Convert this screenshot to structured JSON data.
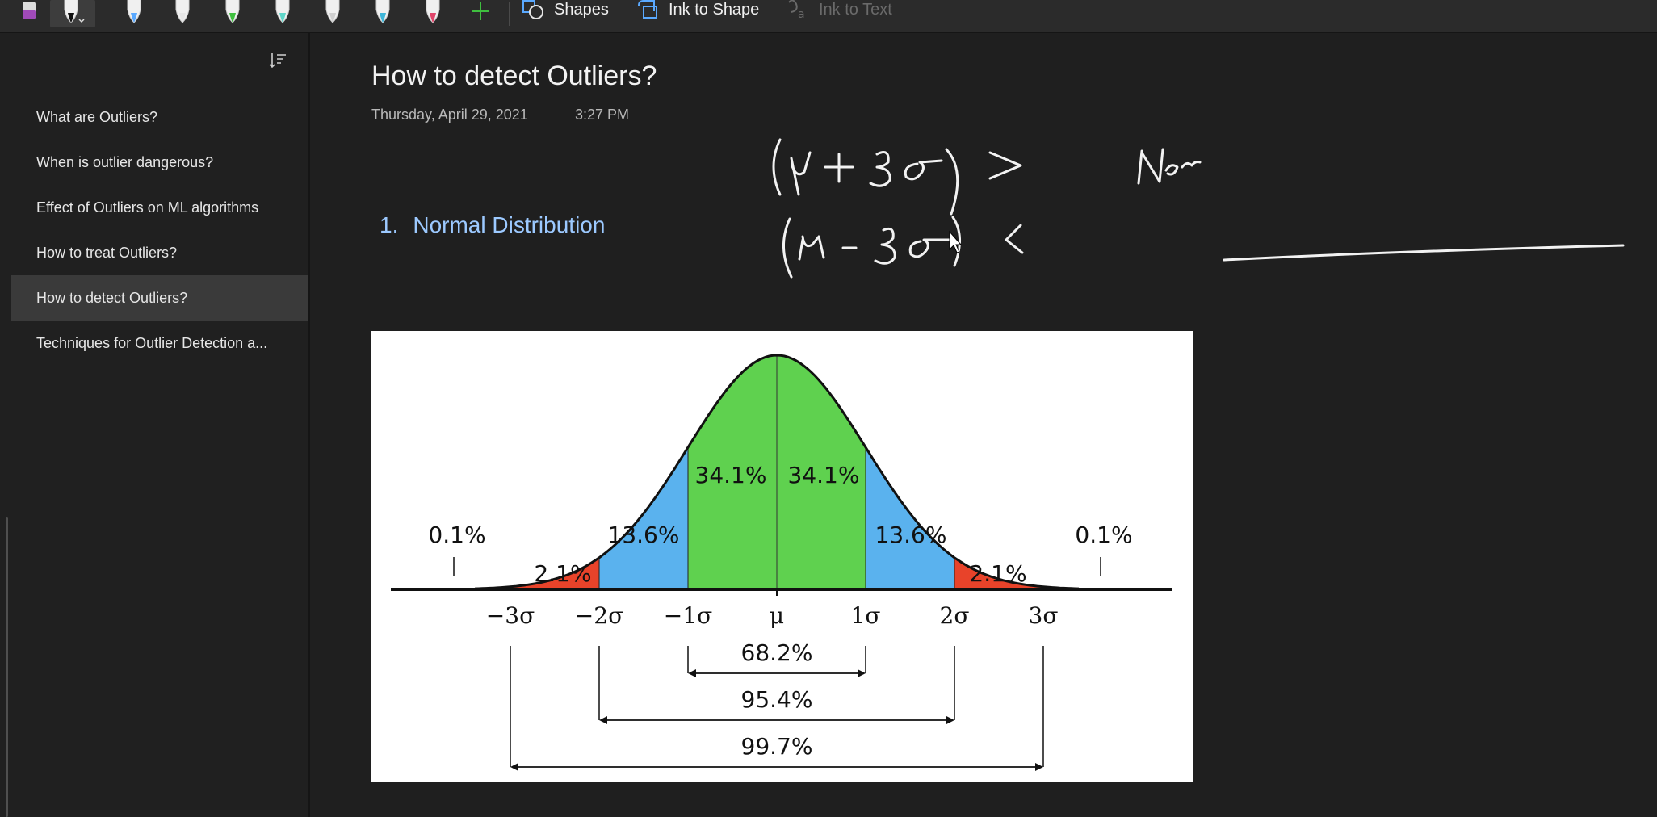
{
  "toolbar": {
    "tools": [
      {
        "name": "pen-purple-icon",
        "color": "#a04ab8"
      },
      {
        "name": "pen-black-icon",
        "color": "#111111",
        "selected": true
      },
      {
        "name": "pen-blue-icon",
        "color": "#5aa9ff"
      },
      {
        "name": "pen-white-icon",
        "color": "#e6e6e6"
      },
      {
        "name": "highlighter-green-icon",
        "color": "#3fbf3f"
      },
      {
        "name": "pen-teal-icon",
        "color": "#5fd6c9"
      },
      {
        "name": "pen-gray-icon",
        "color": "#cfcfcf"
      },
      {
        "name": "pen-cyan-icon",
        "color": "#3fb6d9"
      },
      {
        "name": "pen-red-icon",
        "color": "#e0456a"
      }
    ],
    "add_icon": "plus-icon",
    "shapes_label": "Shapes",
    "ink_to_shape_label": "Ink to Shape",
    "ink_to_text_label": "Ink to Text"
  },
  "sidebar": {
    "pages": [
      {
        "label": "What are Outliers?"
      },
      {
        "label": "When is outlier dangerous?"
      },
      {
        "label": "Effect of Outliers on ML algorithms"
      },
      {
        "label": "How to treat Outliers?"
      },
      {
        "label": "How to detect Outliers?",
        "active": true
      },
      {
        "label": "Techniques for Outlier Detection a..."
      }
    ]
  },
  "page": {
    "title": "How to detect Outliers?",
    "date": "Thursday, April 29, 2021",
    "time": "3:27 PM",
    "heading_number": "1.",
    "heading_text": "Normal Distribution"
  },
  "ink": {
    "line1": "(μ + 3σ) >",
    "line2": "(μ - 3σ) <",
    "scribble": "Nor"
  },
  "chart_data": {
    "type": "area",
    "title": "",
    "x_ticks": [
      "−3σ",
      "−2σ",
      "−1σ",
      "μ",
      "1σ",
      "2σ",
      "3σ"
    ],
    "regions": [
      {
        "from": "−∞",
        "to": "−3σ",
        "percent": "0.1%",
        "color": "#e8432a"
      },
      {
        "from": "−3σ",
        "to": "−2σ",
        "percent": "2.1%",
        "color": "#e8432a"
      },
      {
        "from": "−2σ",
        "to": "−1σ",
        "percent": "13.6%",
        "color": "#5ab2ee"
      },
      {
        "from": "−1σ",
        "to": "μ",
        "percent": "34.1%",
        "color": "#5fd14f"
      },
      {
        "from": "μ",
        "to": "1σ",
        "percent": "34.1%",
        "color": "#5fd14f"
      },
      {
        "from": "1σ",
        "to": "2σ",
        "percent": "13.6%",
        "color": "#5ab2ee"
      },
      {
        "from": "2σ",
        "to": "3σ",
        "percent": "2.1%",
        "color": "#e8432a"
      },
      {
        "from": "3σ",
        "to": "+∞",
        "percent": "0.1%",
        "color": "#e8432a"
      }
    ],
    "spans": [
      {
        "range": "±1σ",
        "percent": "68.2%"
      },
      {
        "range": "±2σ",
        "percent": "95.4%"
      },
      {
        "range": "±3σ",
        "percent": "99.7%"
      }
    ]
  }
}
